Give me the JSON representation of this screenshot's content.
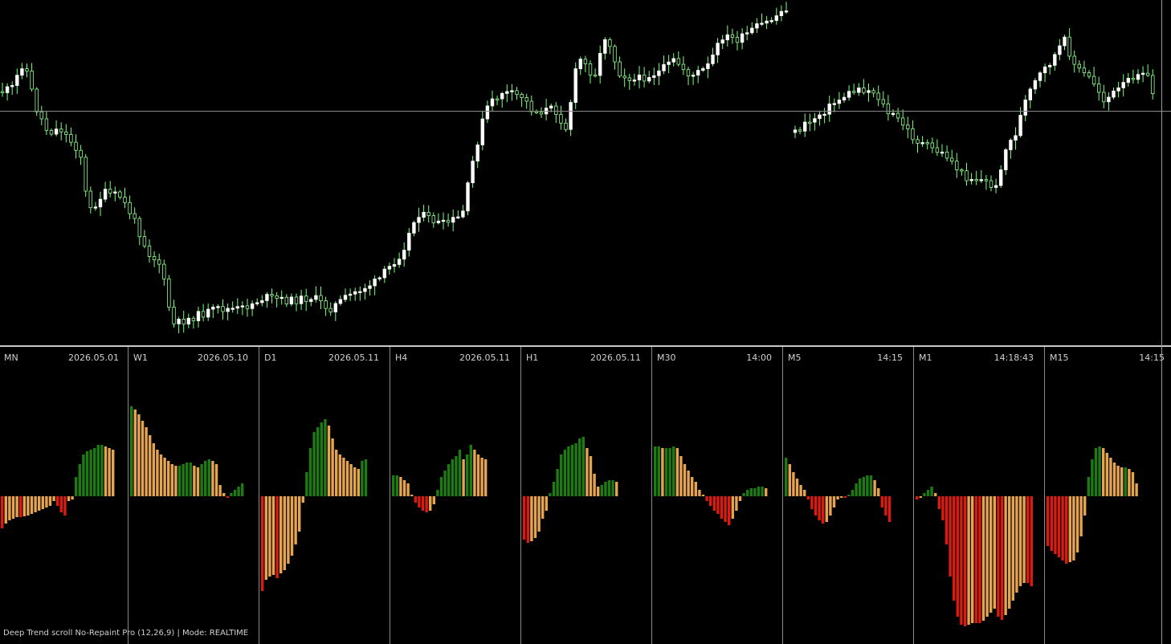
{
  "colors": {
    "background": "#000000",
    "candle_up": "#ffffff",
    "candle_down": "#8fff8f",
    "wick": "#7cff7c",
    "hist_green": "#1e7b14",
    "hist_orange": "#e6a44f",
    "hist_red": "#dd1a10"
  },
  "footer": {
    "text": "Deep Trend scroll No-Repaint Pro (12,26,9) | Mode: REALTIME"
  },
  "chart_data": [
    {
      "type": "candlestick",
      "title": "",
      "ylim": [
        0,
        430
      ],
      "close_path": [
        [
          0,
          115
        ],
        [
          15,
          110
        ],
        [
          30,
          75
        ],
        [
          45,
          135
        ],
        [
          60,
          165
        ],
        [
          75,
          160
        ],
        [
          100,
          190
        ],
        [
          110,
          265
        ],
        [
          130,
          240
        ],
        [
          150,
          245
        ],
        [
          165,
          270
        ],
        [
          185,
          315
        ],
        [
          200,
          330
        ],
        [
          215,
          405
        ],
        [
          240,
          395
        ],
        [
          270,
          385
        ],
        [
          300,
          385
        ],
        [
          330,
          370
        ],
        [
          360,
          375
        ],
        [
          390,
          370
        ],
        [
          410,
          385
        ],
        [
          440,
          365
        ],
        [
          470,
          350
        ],
        [
          500,
          315
        ],
        [
          520,
          265
        ],
        [
          550,
          280
        ],
        [
          575,
          270
        ],
        [
          590,
          195
        ],
        [
          605,
          135
        ],
        [
          625,
          115
        ],
        [
          650,
          120
        ],
        [
          665,
          140
        ],
        [
          690,
          135
        ],
        [
          705,
          160
        ],
        [
          720,
          70
        ],
        [
          740,
          95
        ],
        [
          755,
          40
        ],
        [
          770,
          90
        ],
        [
          790,
          100
        ],
        [
          820,
          90
        ],
        [
          840,
          75
        ],
        [
          860,
          95
        ],
        [
          880,
          85
        ],
        [
          900,
          45
        ],
        [
          920,
          50
        ],
        [
          940,
          35
        ],
        [
          960,
          25
        ],
        [
          985,
          5
        ]
      ],
      "gap_after": 985,
      "close_path_2": [
        [
          990,
          165
        ],
        [
          1010,
          150
        ],
        [
          1030,
          135
        ],
        [
          1050,
          120
        ],
        [
          1070,
          110
        ],
        [
          1090,
          115
        ],
        [
          1105,
          140
        ],
        [
          1120,
          150
        ],
        [
          1140,
          175
        ],
        [
          1160,
          185
        ],
        [
          1180,
          195
        ],
        [
          1200,
          220
        ],
        [
          1225,
          225
        ],
        [
          1240,
          235
        ],
        [
          1250,
          190
        ],
        [
          1265,
          165
        ],
        [
          1275,
          130
        ],
        [
          1290,
          100
        ],
        [
          1310,
          75
        ],
        [
          1325,
          50
        ],
        [
          1340,
          85
        ],
        [
          1360,
          100
        ],
        [
          1375,
          125
        ],
        [
          1395,
          110
        ],
        [
          1410,
          95
        ],
        [
          1425,
          85
        ],
        [
          1440,
          130
        ]
      ],
      "hline_y": 138
    },
    {
      "type": "bar",
      "timeframe": "MN",
      "time": "2026.05.01",
      "values": [
        -40,
        -34,
        -30,
        -28,
        -26,
        -26,
        -25,
        -24,
        -22,
        -20,
        -18,
        -16,
        -14,
        -12,
        -6,
        -12,
        -20,
        -24,
        -6,
        -4,
        24,
        40,
        52,
        56,
        58,
        60,
        64,
        64,
        62,
        60,
        58
      ]
    },
    {
      "type": "bar",
      "timeframe": "W1",
      "time": "2026.05.10",
      "values": [
        112,
        108,
        102,
        94,
        86,
        76,
        66,
        58,
        52,
        48,
        44,
        40,
        38,
        38,
        40,
        42,
        42,
        38,
        36,
        40,
        44,
        46,
        44,
        40,
        14,
        4,
        -2,
        4,
        8,
        12,
        16
      ]
    },
    {
      "type": "bar",
      "timeframe": "D1",
      "time": "2026.05.11",
      "values": [
        -118,
        -104,
        -100,
        -98,
        -102,
        -96,
        -92,
        -84,
        -74,
        -60,
        -44,
        -8,
        30,
        60,
        80,
        86,
        92,
        96,
        88,
        72,
        58,
        52,
        48,
        44,
        40,
        36,
        34,
        44,
        46
      ]
    },
    {
      "type": "bar",
      "timeframe": "H4",
      "time": "2026.05.11",
      "values": [
        26,
        26,
        24,
        20,
        16,
        2,
        -8,
        -14,
        -18,
        -20,
        -18,
        -10,
        8,
        24,
        32,
        40,
        46,
        50,
        58,
        46,
        52,
        64,
        58,
        52,
        48,
        46
      ]
    },
    {
      "type": "bar",
      "timeframe": "H1",
      "time": "2026.05.11",
      "values": [
        -54,
        -58,
        -56,
        -52,
        -44,
        -28,
        -18,
        4,
        18,
        34,
        52,
        58,
        62,
        64,
        66,
        72,
        74,
        60,
        50,
        28,
        12,
        14,
        18,
        20,
        20,
        18
      ]
    },
    {
      "type": "bar",
      "timeframe": "M30",
      "time": "14:00",
      "values": [
        62,
        62,
        60,
        60,
        60,
        62,
        60,
        50,
        40,
        32,
        24,
        18,
        8,
        2,
        -6,
        -12,
        -18,
        -22,
        -28,
        -32,
        -36,
        -28,
        -18,
        -6,
        4,
        8,
        10,
        10,
        12,
        12,
        10
      ]
    },
    {
      "type": "bar",
      "timeframe": "M5",
      "time": "14:15",
      "values": [
        48,
        40,
        30,
        22,
        14,
        8,
        -4,
        -16,
        -24,
        -30,
        -34,
        -32,
        -24,
        -14,
        -4,
        -2,
        -2,
        2,
        8,
        16,
        22,
        24,
        26,
        26,
        20,
        10,
        -14,
        -24,
        -32
      ]
    },
    {
      "type": "bar",
      "timeframe": "M1",
      "time": "14:18:43",
      "values": [
        -4,
        -2,
        4,
        8,
        12,
        4,
        -16,
        -30,
        -60,
        -100,
        -130,
        -150,
        -160,
        -162,
        -160,
        -158,
        -158,
        -158,
        -155,
        -150,
        -145,
        -140,
        -150,
        -154,
        -148,
        -140,
        -130,
        -120,
        -112,
        -108,
        -108,
        -112
      ]
    },
    {
      "type": "bar",
      "timeframe": "M15",
      "time": "14:15",
      "values": [
        -62,
        -68,
        -72,
        -76,
        -80,
        -84,
        -82,
        -80,
        -70,
        -50,
        -24,
        24,
        46,
        60,
        62,
        60,
        54,
        48,
        42,
        38,
        36,
        36,
        34,
        30,
        16
      ]
    }
  ]
}
